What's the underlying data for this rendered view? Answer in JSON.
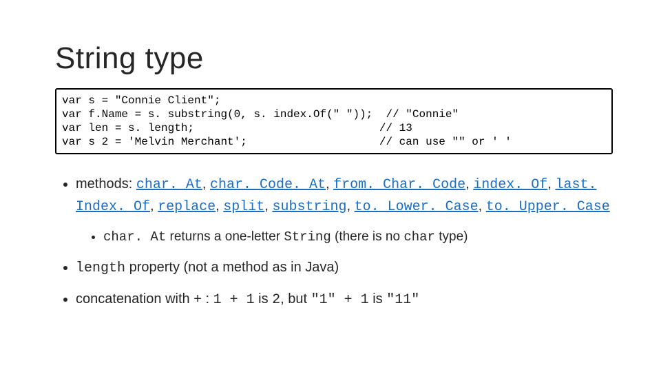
{
  "title": "String type",
  "code": "var s = \"Connie Client\";\nvar f.Name = s. substring(0, s. index.Of(\" \"));  // \"Connie\"\nvar len = s. length;                            // 13\nvar s 2 = 'Melvin Merchant';                    // can use \"\" or ' '",
  "bullets": {
    "methods_prefix": "methods: ",
    "methods_links": [
      "char. At",
      "char. Code. At",
      "from. Char. Code",
      "index. Of",
      "last. Index. Of",
      "replace",
      "split",
      "substring",
      "to. Lower. Case",
      "to. Upper. Case"
    ],
    "charAt_sub": {
      "code1": "char. At",
      "mid": " returns a one-letter ",
      "code2": "String",
      "tail": " (there is no ",
      "code3": "char",
      "tail2": " type)"
    },
    "length_code": "length",
    "length_text": " property (not a method as in Java)",
    "concat_pre": "concatenation with + : ",
    "concat_c1": "1 + 1",
    "concat_mid1": " is ",
    "concat_c2": "2",
    "concat_mid2": ", but ",
    "concat_c3": "\"1\" + 1",
    "concat_mid3": " is ",
    "concat_c4": "\"11\""
  }
}
